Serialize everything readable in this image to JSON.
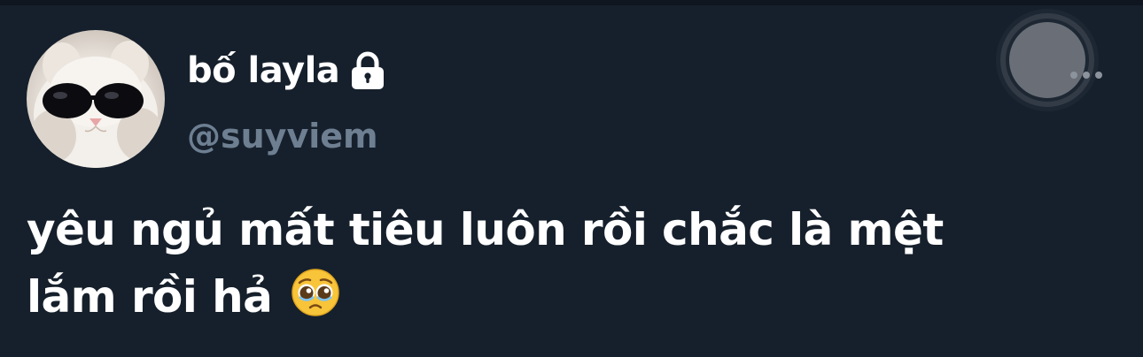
{
  "user": {
    "display_name": "bố layla",
    "handle": "@suyviem",
    "avatar": "cat-with-sunglasses-avatar",
    "protected_icon": "lock-icon"
  },
  "tweet": {
    "text_line_1": "yêu ngủ mất tiêu luôn rồi chắc là mệt",
    "text_line_2": "lắm rồi hả",
    "emoji": "pleading-face-emoji"
  },
  "actions": {
    "more_icon": "more-options-icon"
  },
  "colors": {
    "background": "#16202c",
    "text_primary": "#ffffff",
    "text_secondary": "#6e7f92"
  }
}
